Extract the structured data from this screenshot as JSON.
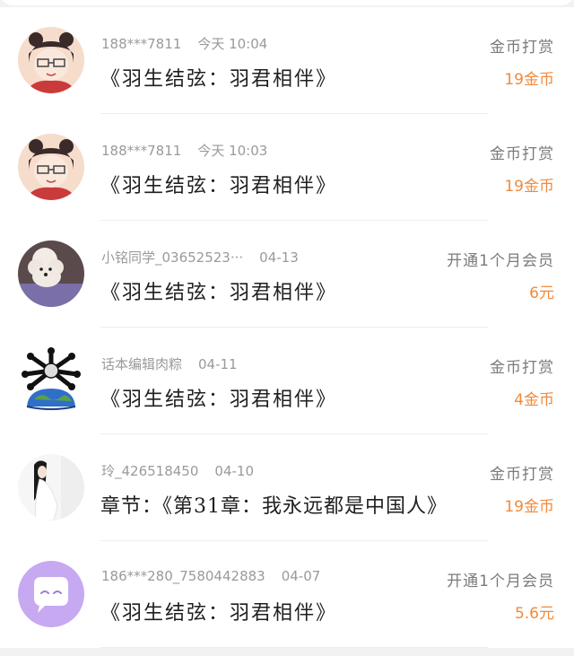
{
  "donations": [
    {
      "user": "188***7811",
      "time": "今天 10:04",
      "title": "《羽生结弦：羽君相伴》",
      "type": "金币打赏",
      "amount": "19金币",
      "avatar_icon": "anime-girl-glasses-avatar"
    },
    {
      "user": "188***7811",
      "time": "今天 10:03",
      "title": "《羽生结弦：羽君相伴》",
      "type": "金币打赏",
      "amount": "19金币",
      "avatar_icon": "anime-girl-glasses-avatar"
    },
    {
      "user": "小铭同学_03652523···",
      "time": "04-13",
      "title": "《羽生结弦：羽君相伴》",
      "type": "开通1个月会员",
      "amount": "6元",
      "avatar_icon": "poodle-dog-avatar"
    },
    {
      "user": "话本编辑肉粽",
      "time": "04-11",
      "title": "《羽生结弦：羽君相伴》",
      "type": "金币打赏",
      "amount": "4金币",
      "avatar_icon": "bones-earth-avatar"
    },
    {
      "user": "玲_426518450",
      "time": "04-10",
      "title": "章节：《第31章：我永远都是中国人》",
      "type": "金币打赏",
      "amount": "19金币",
      "avatar_icon": "woman-white-dress-avatar"
    },
    {
      "user": "186***280_7580442883",
      "time": "04-07",
      "title": "《羽生结弦：羽君相伴》",
      "type": "开通1个月会员",
      "amount": "5.6元",
      "avatar_icon": "default-chat-avatar"
    }
  ],
  "colors": {
    "amount": "#f08a3c",
    "default_avatar_bg": "#c7a9f2"
  }
}
